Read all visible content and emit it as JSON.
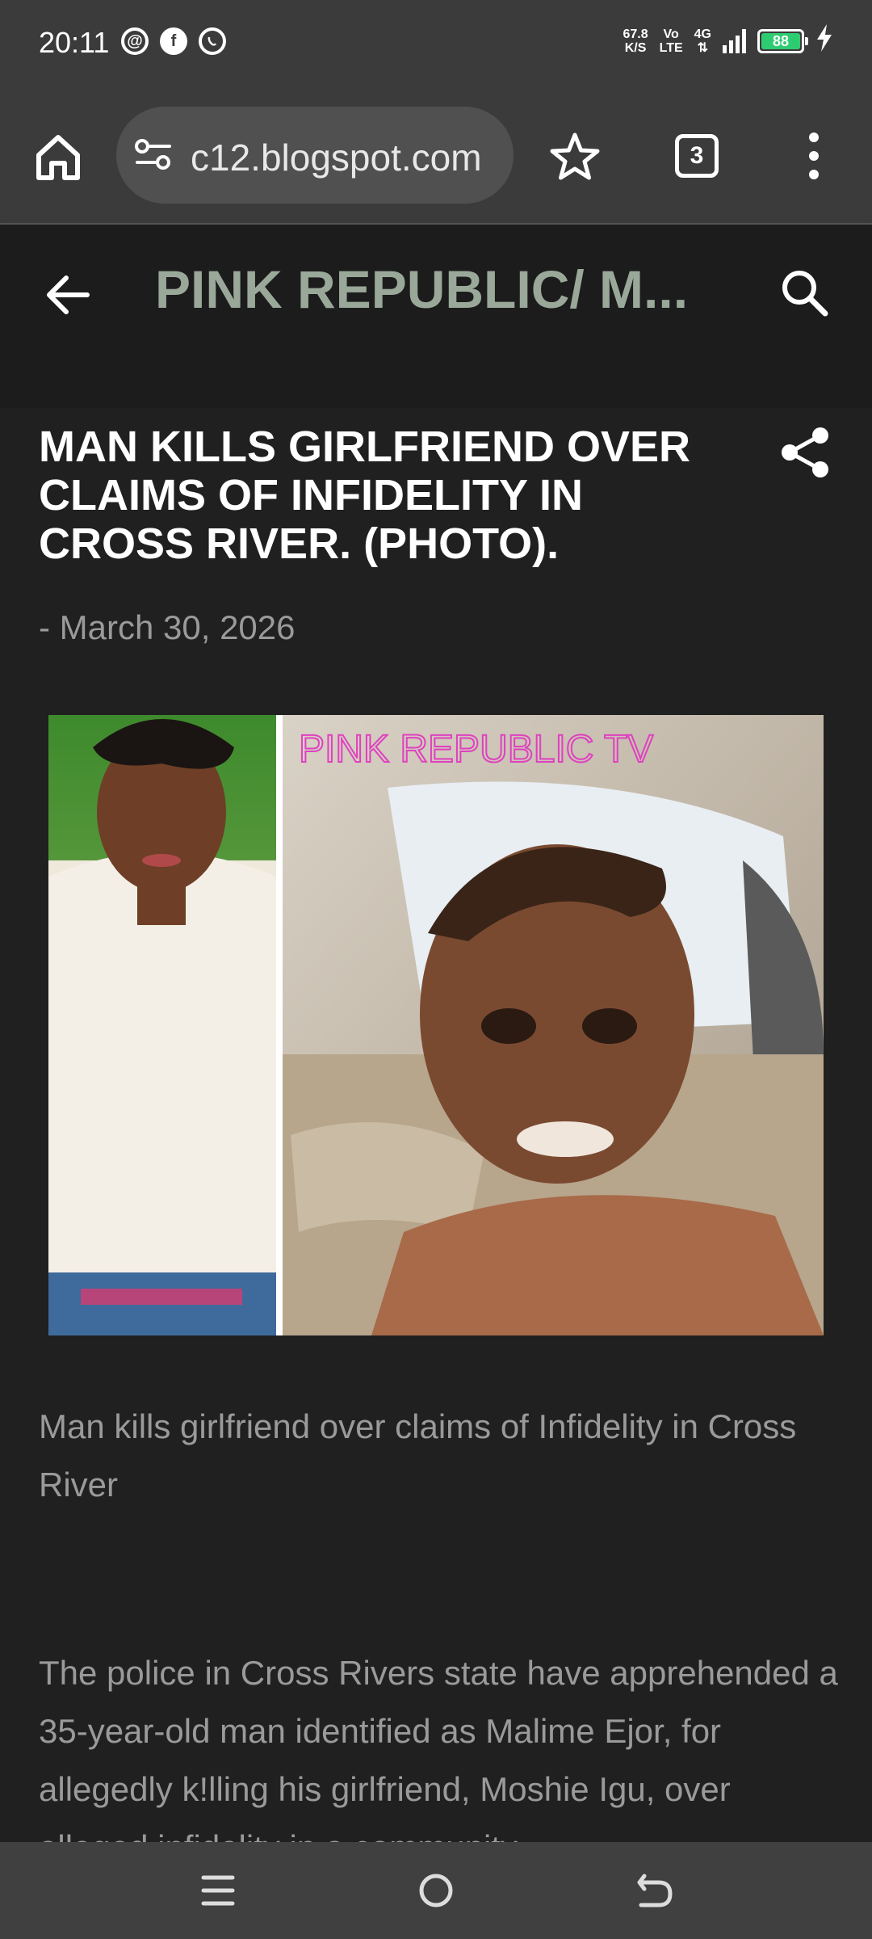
{
  "status_bar": {
    "time": "20:11",
    "notification_icons": [
      "threads-icon",
      "facebook-icon",
      "whatsapp-icon"
    ],
    "net_speed_value": "67.8",
    "net_speed_unit": "K/S",
    "volte_top": "Vo",
    "volte_bottom": "LTE",
    "network": "4G",
    "battery": "88"
  },
  "browser": {
    "url": "c12.blogspot.com",
    "tab_count": "3"
  },
  "site": {
    "title": "PINK REPUBLIC/ M..."
  },
  "post": {
    "title": "MAN KILLS GIRLFRIEND OVER CLAIMS OF INFIDELITY IN CROSS RIVER. (PHOTO).",
    "date": "- March 30, 2026",
    "image_watermark": "PINK REPUBLIC TV",
    "caption": " Man kills girlfriend over claims of Infidelity in Cross River",
    "body": "The police in Cross Rivers state have apprehended a 35-year-old man identified as Malime Ejor, for allegedly k!lling his girlfriend, Moshie Igu, over alleged infidelity in a community"
  },
  "colors": {
    "site_title": "#9aa89a",
    "watermark": "#e040c0",
    "battery": "#2ecc71"
  }
}
